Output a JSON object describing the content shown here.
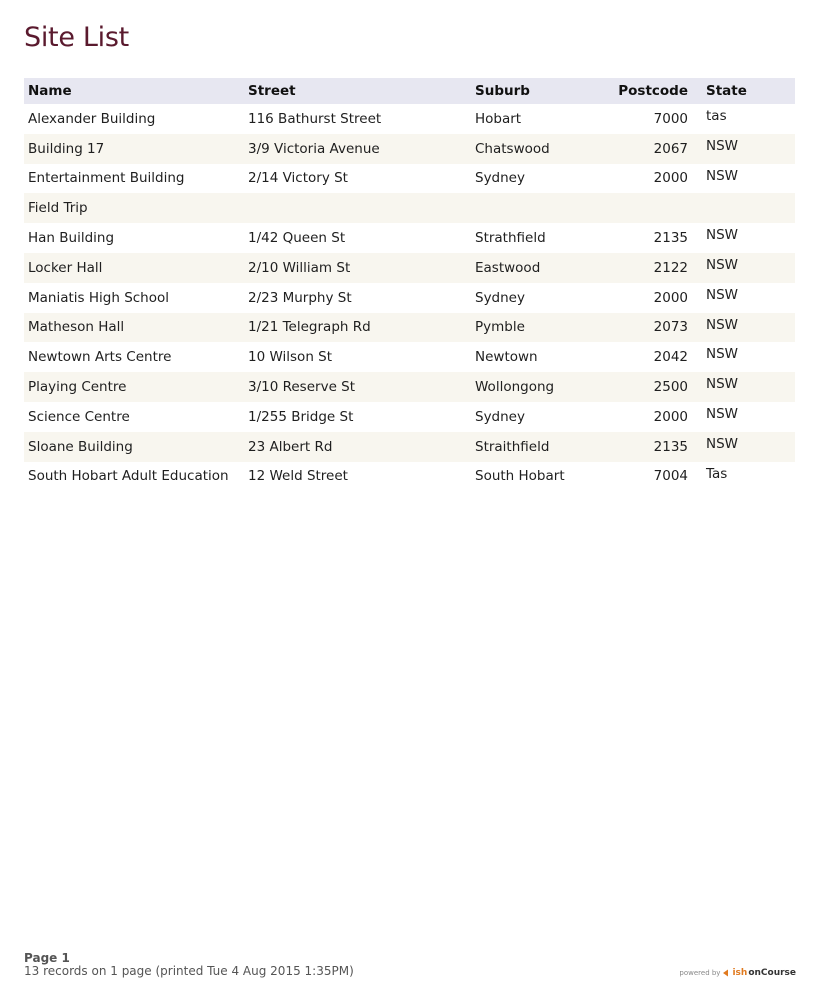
{
  "report": {
    "title": "Site List"
  },
  "table": {
    "columns": [
      "Name",
      "Street",
      "Suburb",
      "Postcode",
      "State"
    ],
    "rows": [
      [
        "Alexander Building",
        "116 Bathurst Street",
        "Hobart",
        "7000",
        "tas"
      ],
      [
        "Building 17",
        "3/9 Victoria Avenue",
        "Chatswood",
        "2067",
        "NSW"
      ],
      [
        "Entertainment Building",
        "2/14 Victory St",
        "Sydney",
        "2000",
        "NSW"
      ],
      [
        "Field Trip",
        "",
        "",
        "",
        ""
      ],
      [
        "Han Building",
        "1/42 Queen St",
        "Strathfield",
        "2135",
        "NSW"
      ],
      [
        "Locker Hall",
        "2/10 William St",
        "Eastwood",
        "2122",
        "NSW"
      ],
      [
        "Maniatis High School",
        "2/23 Murphy St",
        "Sydney",
        "2000",
        "NSW"
      ],
      [
        "Matheson Hall",
        "1/21 Telegraph Rd",
        "Pymble",
        "2073",
        "NSW"
      ],
      [
        "Newtown Arts Centre",
        "10 Wilson St",
        "Newtown",
        "2042",
        "NSW"
      ],
      [
        "Playing Centre",
        "3/10 Reserve St",
        "Wollongong",
        "2500",
        "NSW"
      ],
      [
        "Science Centre",
        "1/255 Bridge St",
        "Sydney",
        "2000",
        "NSW"
      ],
      [
        "Sloane Building",
        "23 Albert Rd",
        "Straithfield",
        "2135",
        "NSW"
      ],
      [
        "South Hobart Adult Education",
        "12 Weld Street",
        "South Hobart",
        "7004",
        "Tas"
      ]
    ]
  },
  "footer": {
    "page_label": "Page 1",
    "summary": "13 records on 1 page (printed Tue 4 Aug 2015 1:35PM)",
    "powered_by": "powered by",
    "logo_ish": "ish",
    "logo_oncourse": "onCourse"
  },
  "colors": {
    "title": "#5a1a2e",
    "header_bg": "#e7e7f1",
    "alt_row_bg": "#f8f6ef",
    "logo_accent": "#e07a1f"
  },
  "icons": {
    "logo": "ish-oncourse-logo-icon"
  }
}
